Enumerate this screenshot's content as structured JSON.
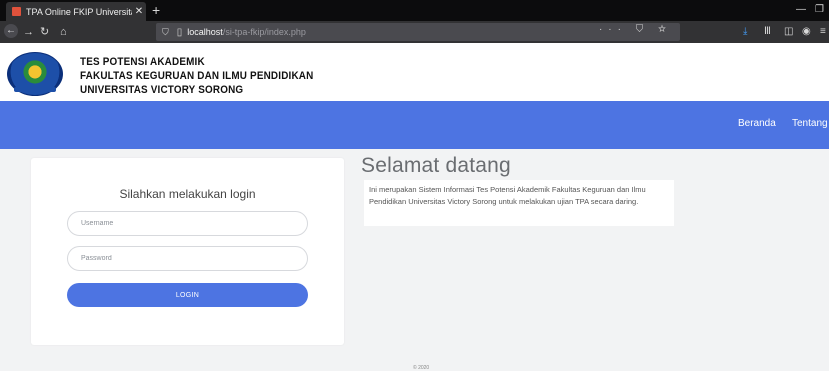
{
  "browser": {
    "tab_title": "TPA Online FKIP Universitas Vi…",
    "tab_close": "✕",
    "new_tab": "+",
    "url_host": "localhost",
    "url_path": "/si-tpa-fkip/index.php",
    "url_actions": "··· ⛉ ☆",
    "icons": [
      "back-arrow-icon",
      "forward-arrow-icon",
      "reload-icon",
      "home-icon",
      "shield-icon",
      "page-icon",
      "download-icon",
      "library-icon",
      "sidebar-icon",
      "account-icon",
      "menu-icon"
    ]
  },
  "header": {
    "line1": "TES POTENSI AKADEMIK",
    "line2": "FAKULTAS KEGURUAN DAN ILMU PENDIDIKAN",
    "line3": "UNIVERSITAS VICTORY SORONG"
  },
  "nav": {
    "beranda": "Beranda",
    "tentang": "Tentang"
  },
  "login": {
    "title": "Silahkan melakukan login",
    "username_placeholder": "Username",
    "password_placeholder": "Password",
    "button": "LOGIN"
  },
  "welcome": {
    "title": "Selamat datang",
    "text": "Ini merupakan Sistem Informasi Tes Potensi Akademik Fakultas Keguruan dan Ilmu Pendidikan Universitas Victory Sorong untuk melakukan ujian TPA secara daring."
  },
  "footer": {
    "text": "© 2020"
  },
  "colors": {
    "accent": "#4d74e2",
    "chrome_dark": "#0c0c0d",
    "chrome_toolbar": "#323234"
  }
}
